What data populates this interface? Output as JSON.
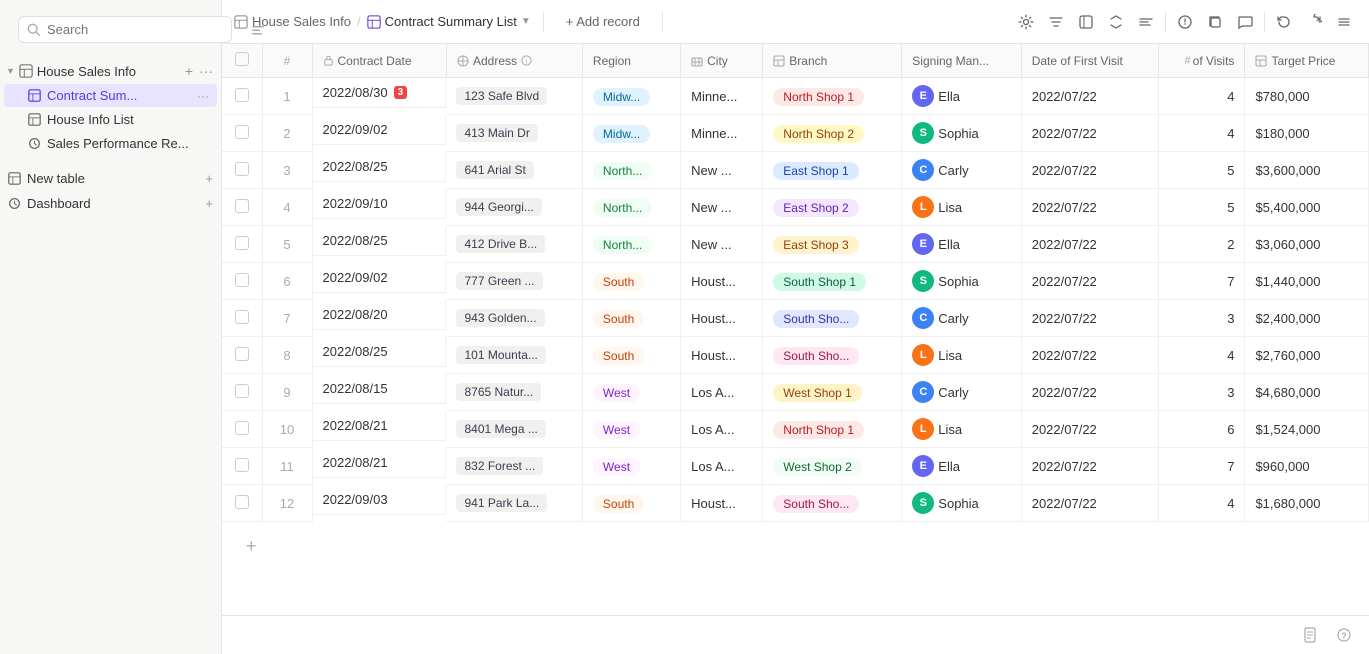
{
  "sidebar": {
    "search_placeholder": "Search",
    "collapse_label": "Collapse sidebar",
    "groups": [
      {
        "id": "house-sales-info",
        "label": "House Sales Info",
        "expanded": true,
        "items": [
          {
            "id": "contract-sum",
            "label": "Contract Sum...",
            "active": true,
            "icon": "table-icon"
          },
          {
            "id": "house-info-list",
            "label": "House Info List",
            "active": false,
            "icon": "table-icon"
          },
          {
            "id": "sales-performance",
            "label": "Sales Performance Re...",
            "active": false,
            "icon": "clock-icon"
          }
        ]
      }
    ],
    "bottom_items": [
      {
        "id": "new-table",
        "label": "New table",
        "icon": "table-icon"
      },
      {
        "id": "dashboard",
        "label": "Dashboard",
        "icon": "clock-icon"
      }
    ]
  },
  "topbar": {
    "breadcrumb_db": "House Sales Info",
    "breadcrumb_view": "Contract Summary List",
    "add_record_label": "+ Add record",
    "icons": [
      "settings",
      "filter",
      "fields",
      "sort",
      "group",
      "reminder",
      "duplicate",
      "comment",
      "undo",
      "redo",
      "more"
    ]
  },
  "table": {
    "columns": [
      {
        "id": "checkbox",
        "label": ""
      },
      {
        "id": "row-num",
        "label": "#"
      },
      {
        "id": "contract-date",
        "label": "Contract Date",
        "locked": true
      },
      {
        "id": "address",
        "label": "Address"
      },
      {
        "id": "region",
        "label": "Region"
      },
      {
        "id": "city",
        "label": "City"
      },
      {
        "id": "branch",
        "label": "Branch"
      },
      {
        "id": "signing-manager",
        "label": "Signing Man..."
      },
      {
        "id": "date-first-visit",
        "label": "Date of First Visit"
      },
      {
        "id": "num-visits",
        "label": "# of Visits"
      },
      {
        "id": "target-price",
        "label": "Target Price"
      }
    ],
    "rows": [
      {
        "num": 1,
        "date": "2022/08/30",
        "badge": 3,
        "address": "123 Safe Blvd",
        "region": "Midw...",
        "region_class": "region-midw",
        "city": "Minne...",
        "branch": "North Shop 1",
        "branch_class": "branch-ns1",
        "manager": "Ella",
        "manager_class": "av-e",
        "first_visit": "2022/07/22",
        "visits": 4,
        "price": "$780,000"
      },
      {
        "num": 2,
        "date": "2022/09/02",
        "badge": null,
        "address": "413 Main Dr",
        "region": "Midw...",
        "region_class": "region-midw",
        "city": "Minne...",
        "branch": "North Shop 2",
        "branch_class": "branch-ns2",
        "manager": "Sophia",
        "manager_class": "av-s",
        "first_visit": "2022/07/22",
        "visits": 4,
        "price": "$180,000"
      },
      {
        "num": 3,
        "date": "2022/08/25",
        "badge": null,
        "address": "641 Arial St",
        "region": "North...",
        "region_class": "region-north",
        "city": "New ...",
        "branch": "East Shop 1",
        "branch_class": "branch-es1",
        "manager": "Carly",
        "manager_class": "av-c",
        "first_visit": "2022/07/22",
        "visits": 5,
        "price": "$3,600,000"
      },
      {
        "num": 4,
        "date": "2022/09/10",
        "badge": null,
        "address": "944 Georgi...",
        "region": "North...",
        "region_class": "region-north",
        "city": "New ...",
        "branch": "East Shop 2",
        "branch_class": "branch-es2",
        "manager": "Lisa",
        "manager_class": "av-l",
        "first_visit": "2022/07/22",
        "visits": 5,
        "price": "$5,400,000"
      },
      {
        "num": 5,
        "date": "2022/08/25",
        "badge": null,
        "address": "412 Drive B...",
        "region": "North...",
        "region_class": "region-north",
        "city": "New ...",
        "branch": "East Shop 3",
        "branch_class": "branch-es3",
        "manager": "Ella",
        "manager_class": "av-e",
        "first_visit": "2022/07/22",
        "visits": 2,
        "price": "$3,060,000"
      },
      {
        "num": 6,
        "date": "2022/09/02",
        "badge": null,
        "address": "777 Green ...",
        "region": "South",
        "region_class": "region-south",
        "city": "Houst...",
        "branch": "South Shop 1",
        "branch_class": "branch-ss1",
        "manager": "Sophia",
        "manager_class": "av-s",
        "first_visit": "2022/07/22",
        "visits": 7,
        "price": "$1,440,000"
      },
      {
        "num": 7,
        "date": "2022/08/20",
        "badge": null,
        "address": "943 Golden...",
        "region": "South",
        "region_class": "region-south",
        "city": "Houst...",
        "branch": "South Sho...",
        "branch_class": "branch-ss2",
        "manager": "Carly",
        "manager_class": "av-c",
        "first_visit": "2022/07/22",
        "visits": 3,
        "price": "$2,400,000"
      },
      {
        "num": 8,
        "date": "2022/08/25",
        "badge": null,
        "address": "101 Mounta...",
        "region": "South",
        "region_class": "region-south",
        "city": "Houst...",
        "branch": "South Sho...",
        "branch_class": "branch-ss3",
        "manager": "Lisa",
        "manager_class": "av-l",
        "first_visit": "2022/07/22",
        "visits": 4,
        "price": "$2,760,000"
      },
      {
        "num": 9,
        "date": "2022/08/15",
        "badge": null,
        "address": "8765 Natur...",
        "region": "West",
        "region_class": "region-west",
        "city": "Los A...",
        "branch": "West Shop 1",
        "branch_class": "branch-ws1",
        "manager": "Carly",
        "manager_class": "av-c",
        "first_visit": "2022/07/22",
        "visits": 3,
        "price": "$4,680,000"
      },
      {
        "num": 10,
        "date": "2022/08/21",
        "badge": null,
        "address": "8401 Mega ...",
        "region": "West",
        "region_class": "region-west",
        "city": "Los A...",
        "branch": "North Shop 1",
        "branch_class": "branch-ns1",
        "manager": "Lisa",
        "manager_class": "av-l",
        "first_visit": "2022/07/22",
        "visits": 6,
        "price": "$1,524,000"
      },
      {
        "num": 11,
        "date": "2022/08/21",
        "badge": null,
        "address": "832 Forest ...",
        "region": "West",
        "region_class": "region-west",
        "city": "Los A...",
        "branch": "West Shop 2",
        "branch_class": "branch-ws2",
        "manager": "Ella",
        "manager_class": "av-e",
        "first_visit": "2022/07/22",
        "visits": 7,
        "price": "$960,000"
      },
      {
        "num": 12,
        "date": "2022/09/03",
        "badge": null,
        "address": "941 Park La...",
        "region": "South",
        "region_class": "region-south",
        "city": "Houst...",
        "branch": "South Sho...",
        "branch_class": "branch-ss3",
        "manager": "Sophia",
        "manager_class": "av-s",
        "first_visit": "2022/07/22",
        "visits": 4,
        "price": "$1,680,000"
      }
    ],
    "add_row_label": "+"
  }
}
